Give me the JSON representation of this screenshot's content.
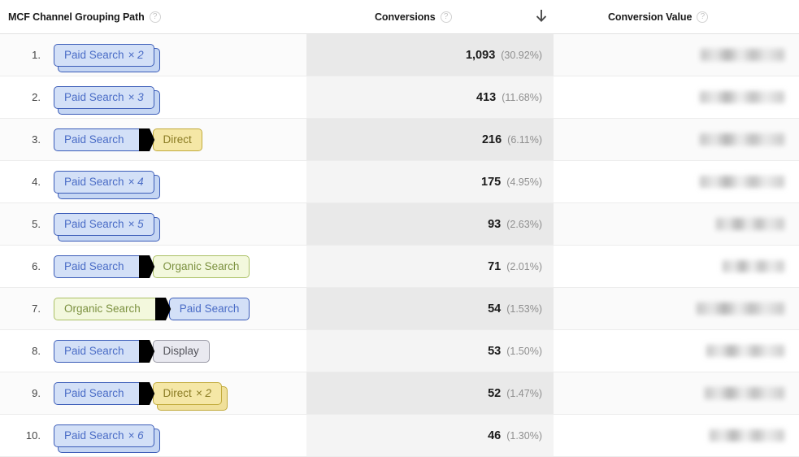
{
  "header": {
    "path_label": "MCF Channel Grouping Path",
    "conversions_label": "Conversions",
    "conversion_value_label": "Conversion Value",
    "help_glyph": "?",
    "sort_direction": "descending",
    "sort_icon": "arrow-down-icon"
  },
  "colors": {
    "paid_search_fill": "#d3e0f7",
    "paid_search_border": "#3b5cb8",
    "paid_search_text": "#4a6cc6",
    "direct_fill": "#f5e7a6",
    "direct_border": "#c2ab3c",
    "direct_text": "#8a7b23",
    "organic_fill": "#f3f8dd",
    "organic_border": "#abc066",
    "organic_text": "#7c9140",
    "display_fill": "#e9e9f0",
    "display_border": "#9a9aa6",
    "display_text": "#55555c"
  },
  "channel_classes": {
    "Paid Search": "ch-paid",
    "Direct": "ch-direct",
    "Organic Search": "ch-organic",
    "Display": "ch-display"
  },
  "rows": [
    {
      "index": "1.",
      "path": [
        {
          "channel": "Paid Search",
          "multiplier": "× 2"
        }
      ],
      "conversions": "1,093",
      "percent": "(30.92%)",
      "conversion_value": "redacted"
    },
    {
      "index": "2.",
      "path": [
        {
          "channel": "Paid Search",
          "multiplier": "× 3"
        }
      ],
      "conversions": "413",
      "percent": "(11.68%)",
      "conversion_value": "redacted"
    },
    {
      "index": "3.",
      "path": [
        {
          "channel": "Paid Search",
          "multiplier": ""
        },
        {
          "channel": "Direct",
          "multiplier": ""
        }
      ],
      "conversions": "216",
      "percent": "(6.11%)",
      "conversion_value": "redacted"
    },
    {
      "index": "4.",
      "path": [
        {
          "channel": "Paid Search",
          "multiplier": "× 4"
        }
      ],
      "conversions": "175",
      "percent": "(4.95%)",
      "conversion_value": "redacted"
    },
    {
      "index": "5.",
      "path": [
        {
          "channel": "Paid Search",
          "multiplier": "× 5"
        }
      ],
      "conversions": "93",
      "percent": "(2.63%)",
      "conversion_value": "redacted"
    },
    {
      "index": "6.",
      "path": [
        {
          "channel": "Paid Search",
          "multiplier": ""
        },
        {
          "channel": "Organic Search",
          "multiplier": ""
        }
      ],
      "conversions": "71",
      "percent": "(2.01%)",
      "conversion_value": "redacted"
    },
    {
      "index": "7.",
      "path": [
        {
          "channel": "Organic Search",
          "multiplier": ""
        },
        {
          "channel": "Paid Search",
          "multiplier": ""
        }
      ],
      "conversions": "54",
      "percent": "(1.53%)",
      "conversion_value": "redacted"
    },
    {
      "index": "8.",
      "path": [
        {
          "channel": "Paid Search",
          "multiplier": ""
        },
        {
          "channel": "Display",
          "multiplier": ""
        }
      ],
      "conversions": "53",
      "percent": "(1.50%)",
      "conversion_value": "redacted"
    },
    {
      "index": "9.",
      "path": [
        {
          "channel": "Paid Search",
          "multiplier": ""
        },
        {
          "channel": "Direct",
          "multiplier": "× 2"
        }
      ],
      "conversions": "52",
      "percent": "(1.47%)",
      "conversion_value": "redacted"
    },
    {
      "index": "10.",
      "path": [
        {
          "channel": "Paid Search",
          "multiplier": "× 6"
        }
      ],
      "conversions": "46",
      "percent": "(1.30%)",
      "conversion_value": "redacted"
    }
  ],
  "redaction_widths": [
    103,
    104,
    104,
    104,
    84,
    76,
    108,
    96,
    98,
    92
  ]
}
